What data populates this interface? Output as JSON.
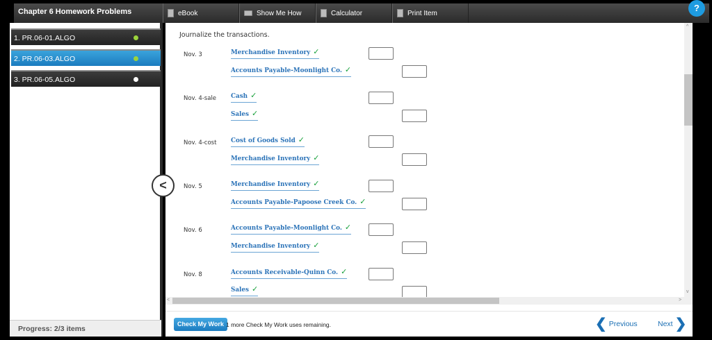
{
  "header": {
    "title": "Chapter 6 Homework Problems",
    "toolbar": [
      {
        "label": "eBook",
        "icon": "book-icon"
      },
      {
        "label": "Show Me How",
        "icon": "video-icon"
      },
      {
        "label": "Calculator",
        "icon": "calculator-icon"
      },
      {
        "label": "Print Item",
        "icon": "print-icon"
      }
    ],
    "help_icon": "headset-icon"
  },
  "sidebar": {
    "items": [
      {
        "label": "1. PR.06-01.ALGO",
        "status_color": "#9bd33c"
      },
      {
        "label": "2. PR.06-03.ALGO",
        "status_color": "#9bd33c"
      },
      {
        "label": "3. PR.06-05.ALGO",
        "status_color": "#ffffff"
      }
    ],
    "progress": "Progress:  2/3 items"
  },
  "main": {
    "instruction": "Journalize the transactions.",
    "entries": [
      {
        "date": "Nov. 3",
        "debit": "Merchandise Inventory",
        "credit": "Accounts Payable-Moonlight Co."
      },
      {
        "date": "Nov. 4-sale",
        "debit": "Cash",
        "credit": "Sales"
      },
      {
        "date": "Nov. 4-cost",
        "debit": "Cost of Goods Sold",
        "credit": "Merchandise Inventory"
      },
      {
        "date": "Nov. 5",
        "debit": "Merchandise Inventory",
        "credit": "Accounts Payable-Papoose Creek Co."
      },
      {
        "date": "Nov. 6",
        "debit": "Accounts Payable-Moonlight Co.",
        "credit": "Merchandise Inventory"
      },
      {
        "date": "Nov. 8",
        "debit": "Accounts Receivable-Quinn Co.",
        "credit": "Sales"
      }
    ],
    "check_mark": "✓"
  },
  "footer": {
    "check_button": "Check My Work",
    "remaining": "1 more Check My Work uses remaining.",
    "previous": "Previous",
    "next": "Next"
  },
  "colors": {
    "accent": "#1b7cbf",
    "check": "#17a03a",
    "link": "#2b73b8"
  }
}
